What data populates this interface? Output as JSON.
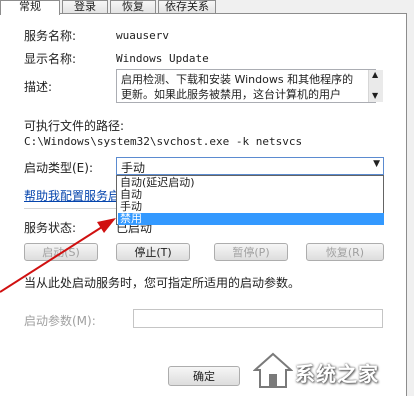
{
  "tabs": [
    "常规",
    "登录",
    "恢复",
    "依存关系"
  ],
  "general": {
    "service_name_label": "服务名称:",
    "service_name_value": "wuauserv",
    "display_name_label": "显示名称:",
    "display_name_value": "Windows Update",
    "description_label": "描述:",
    "description_line1": "启用检测、下载和安装 Windows 和其他程序的",
    "description_line2": "更新。如果此服务被禁用，这台计算机的用户",
    "path_label": "可执行文件的路径:",
    "path_value": "C:\\Windows\\system32\\svchost.exe -k netsvcs",
    "startup_type_label": "启动类型(E):",
    "startup_type_value": "手动",
    "startup_options": [
      "自动(延迟启动)",
      "自动",
      "手动",
      "禁用"
    ],
    "selected_option_index": 3,
    "help_link": "帮助我配置服务启",
    "status_label": "服务状态:",
    "status_value": "已启动",
    "buttons": {
      "start": "启动(S)",
      "stop": "停止(T)",
      "pause": "暂停(P)",
      "resume": "恢复(R)"
    },
    "hint": "当从此处启动服务时，您可指定所适用的启动参数。",
    "start_params_label": "启动参数(M):",
    "ok_button": "确定"
  },
  "watermark": {
    "text": "系统之家"
  },
  "colors": {
    "highlight": "#3399ff",
    "arrow": "#d01010",
    "link": "#0645ad"
  }
}
